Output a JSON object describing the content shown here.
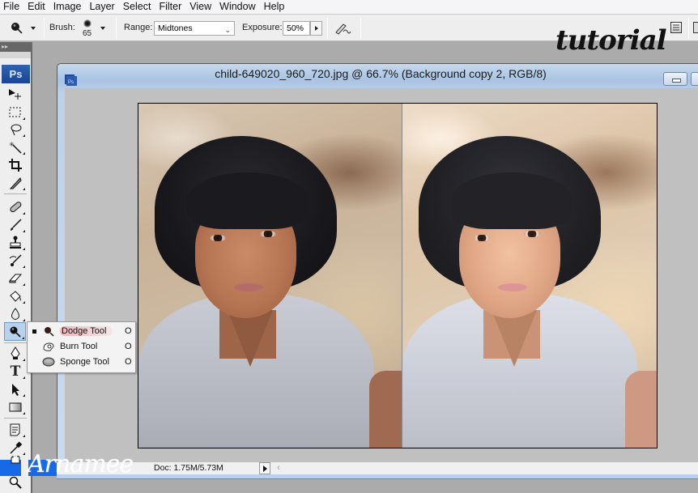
{
  "menu": [
    "File",
    "Edit",
    "Image",
    "Layer",
    "Select",
    "Filter",
    "View",
    "Window",
    "Help"
  ],
  "options_bar": {
    "tool_preset_icon": "dodge-tool-icon",
    "brush_label": "Brush:",
    "brush_size": "65",
    "range_label": "Range:",
    "range_value": "Midtones",
    "exposure_label": "Exposure:",
    "exposure_value": "50%",
    "airbrush_icon": "airbrush-icon",
    "workspace_icon": "workspace-icon"
  },
  "branding": {
    "tutorial_text": "tutorial",
    "watermark_text": "Arnamee",
    "watermark_color": "#1769e8"
  },
  "toolbox": {
    "logo": "Ps",
    "tools": [
      {
        "name": "move-tool",
        "icon": "move-icon"
      },
      {
        "name": "marquee-tool",
        "icon": "marquee-icon"
      },
      {
        "name": "lasso-tool",
        "icon": "lasso-icon"
      },
      {
        "name": "magic-wand-tool",
        "icon": "magic-wand-icon"
      },
      {
        "name": "crop-tool",
        "icon": "crop-icon"
      },
      {
        "name": "slice-tool",
        "icon": "slice-icon"
      },
      {
        "name": "healing-brush-tool",
        "icon": "bandage-icon"
      },
      {
        "name": "brush-tool",
        "icon": "brush-icon"
      },
      {
        "name": "clone-stamp-tool",
        "icon": "stamp-icon"
      },
      {
        "name": "history-brush-tool",
        "icon": "history-brush-icon"
      },
      {
        "name": "eraser-tool",
        "icon": "eraser-icon"
      },
      {
        "name": "paint-bucket-tool",
        "icon": "paint-bucket-icon"
      },
      {
        "name": "blur-tool",
        "icon": "drop-icon"
      },
      {
        "name": "dodge-tool",
        "icon": "dodge-icon",
        "active": true
      },
      {
        "name": "pen-tool",
        "icon": "pen-icon"
      },
      {
        "name": "type-tool",
        "icon": "type-icon"
      },
      {
        "name": "path-selection-tool",
        "icon": "arrow-icon"
      },
      {
        "name": "shape-tool",
        "icon": "rectangle-icon"
      },
      {
        "name": "notes-tool",
        "icon": "note-icon"
      },
      {
        "name": "eyedropper-tool",
        "icon": "eyedropper-icon"
      },
      {
        "name": "hand-tool",
        "icon": "hand-icon"
      },
      {
        "name": "zoom-tool",
        "icon": "magnifier-icon"
      }
    ]
  },
  "flyout": {
    "items": [
      {
        "label": "Dodge Tool",
        "shortcut": "O",
        "selected": true
      },
      {
        "label": "Burn Tool",
        "shortcut": "O",
        "selected": false
      },
      {
        "label": "Sponge Tool",
        "shortcut": "O",
        "selected": false
      }
    ]
  },
  "document": {
    "title": "child-649020_960_720.jpg @ 66.7% (Background copy 2, RGB/8)",
    "icon_label": "Ps",
    "status": "Doc: 1.75M/5.73M"
  }
}
